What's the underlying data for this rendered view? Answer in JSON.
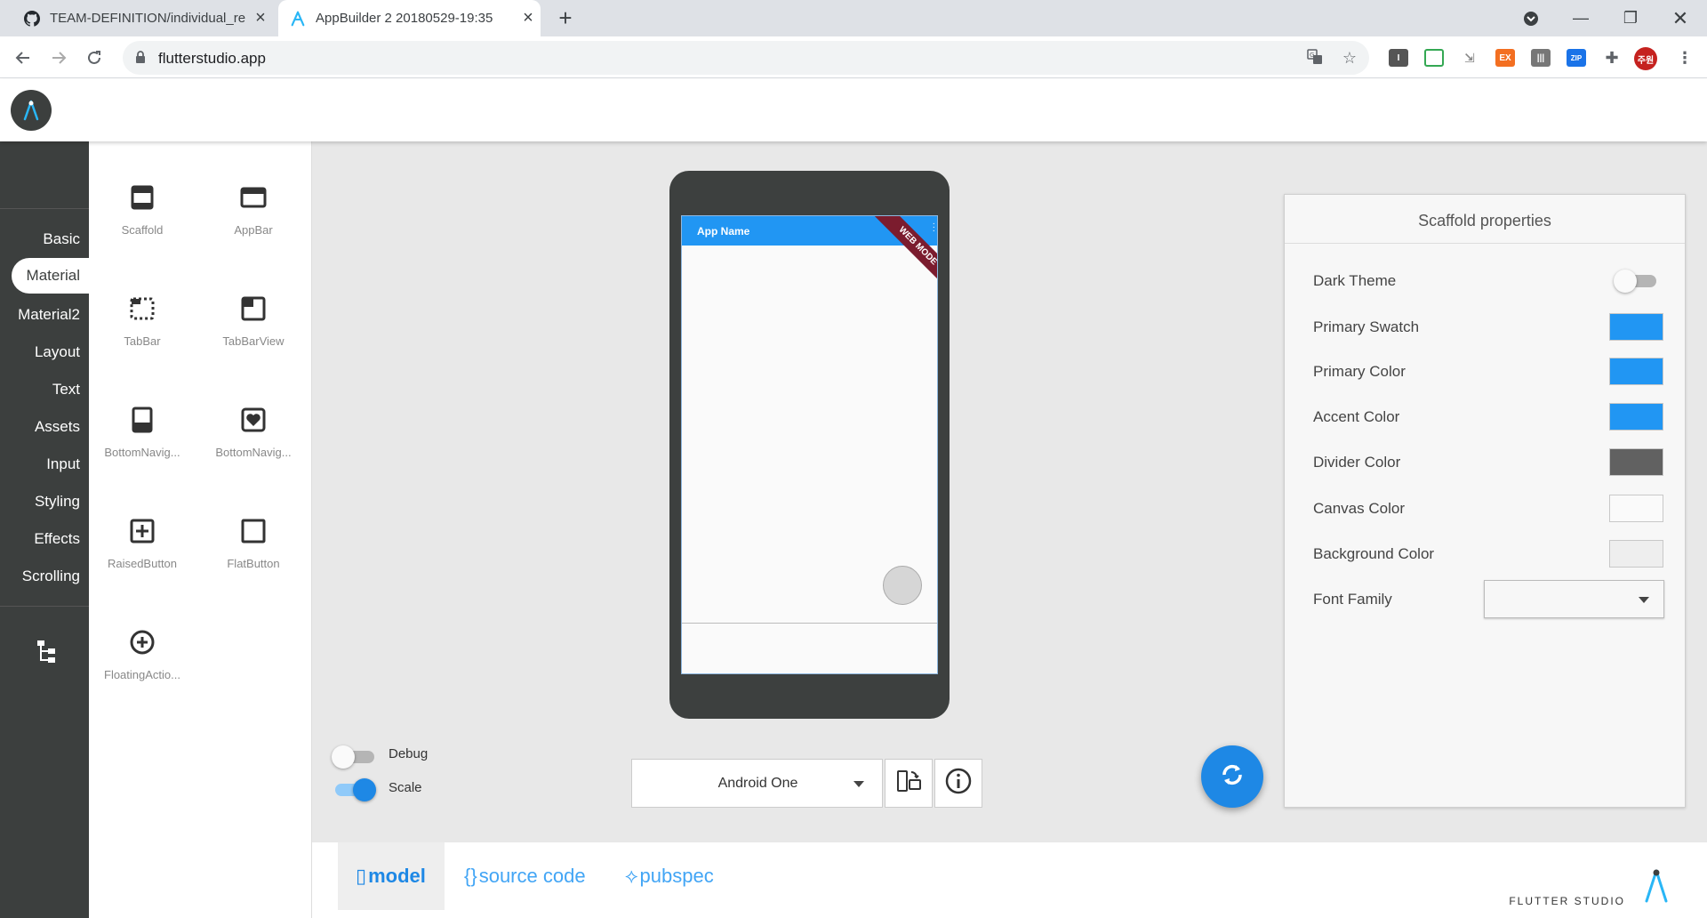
{
  "browser": {
    "tabs": [
      {
        "title": "TEAM-DEFINITION/individual_re",
        "icon": "github-icon"
      },
      {
        "title": "AppBuilder 2 20180529-19:35",
        "icon": "flutter-studio-icon"
      }
    ],
    "url": "flutterstudio.app",
    "profile_badge": "주원",
    "extensions": [
      "EX",
      "ZIP"
    ]
  },
  "sidebar": {
    "categories": [
      "Basic",
      "Material",
      "Material2",
      "Layout",
      "Text",
      "Assets",
      "Input",
      "Styling",
      "Effects",
      "Scrolling"
    ],
    "active": "Material"
  },
  "palette": {
    "widgets": [
      {
        "label": "Scaffold",
        "icon": "scaffold-icon"
      },
      {
        "label": "AppBar",
        "icon": "appbar-icon"
      },
      {
        "label": "TabBar",
        "icon": "tabbar-icon"
      },
      {
        "label": "TabBarView",
        "icon": "tabbarview-icon"
      },
      {
        "label": "BottomNavig...",
        "icon": "bottom-navigation-icon"
      },
      {
        "label": "BottomNavig...",
        "icon": "bottom-navigation-item-icon"
      },
      {
        "label": "RaisedButton",
        "icon": "raised-button-icon"
      },
      {
        "label": "FlatButton",
        "icon": "flat-button-icon"
      },
      {
        "label": "FloatingActio...",
        "icon": "floating-action-button-icon"
      }
    ]
  },
  "preview": {
    "app_title": "App Name",
    "ribbon": "WEB MODE",
    "debug_label": "Debug",
    "debug_on": false,
    "scale_label": "Scale",
    "scale_on": true,
    "device": "Android One"
  },
  "properties": {
    "title": "Scaffold properties",
    "dark_theme": {
      "label": "Dark Theme",
      "value": false
    },
    "colors": [
      {
        "label": "Primary Swatch",
        "color": "#2196f3"
      },
      {
        "label": "Primary Color",
        "color": "#2196f3"
      },
      {
        "label": "Accent Color",
        "color": "#2196f3"
      },
      {
        "label": "Divider Color",
        "color": "#616161"
      },
      {
        "label": "Canvas Color",
        "color": "#fafafa"
      },
      {
        "label": "Background Color",
        "color": "#eeeeee"
      }
    ],
    "font_family": {
      "label": "Font Family",
      "value": ""
    }
  },
  "bottom_tabs": [
    {
      "icon": "▯",
      "label": "model",
      "active": true
    },
    {
      "icon": "{}",
      "label": "source code",
      "active": false
    },
    {
      "icon": "⟡",
      "label": "pubspec",
      "active": false
    }
  ],
  "brand": "FLUTTER STUDIO",
  "colors": {
    "accent": "#1e88e5",
    "sidebar": "#3c3f3e",
    "appbar": "#2196f3"
  }
}
